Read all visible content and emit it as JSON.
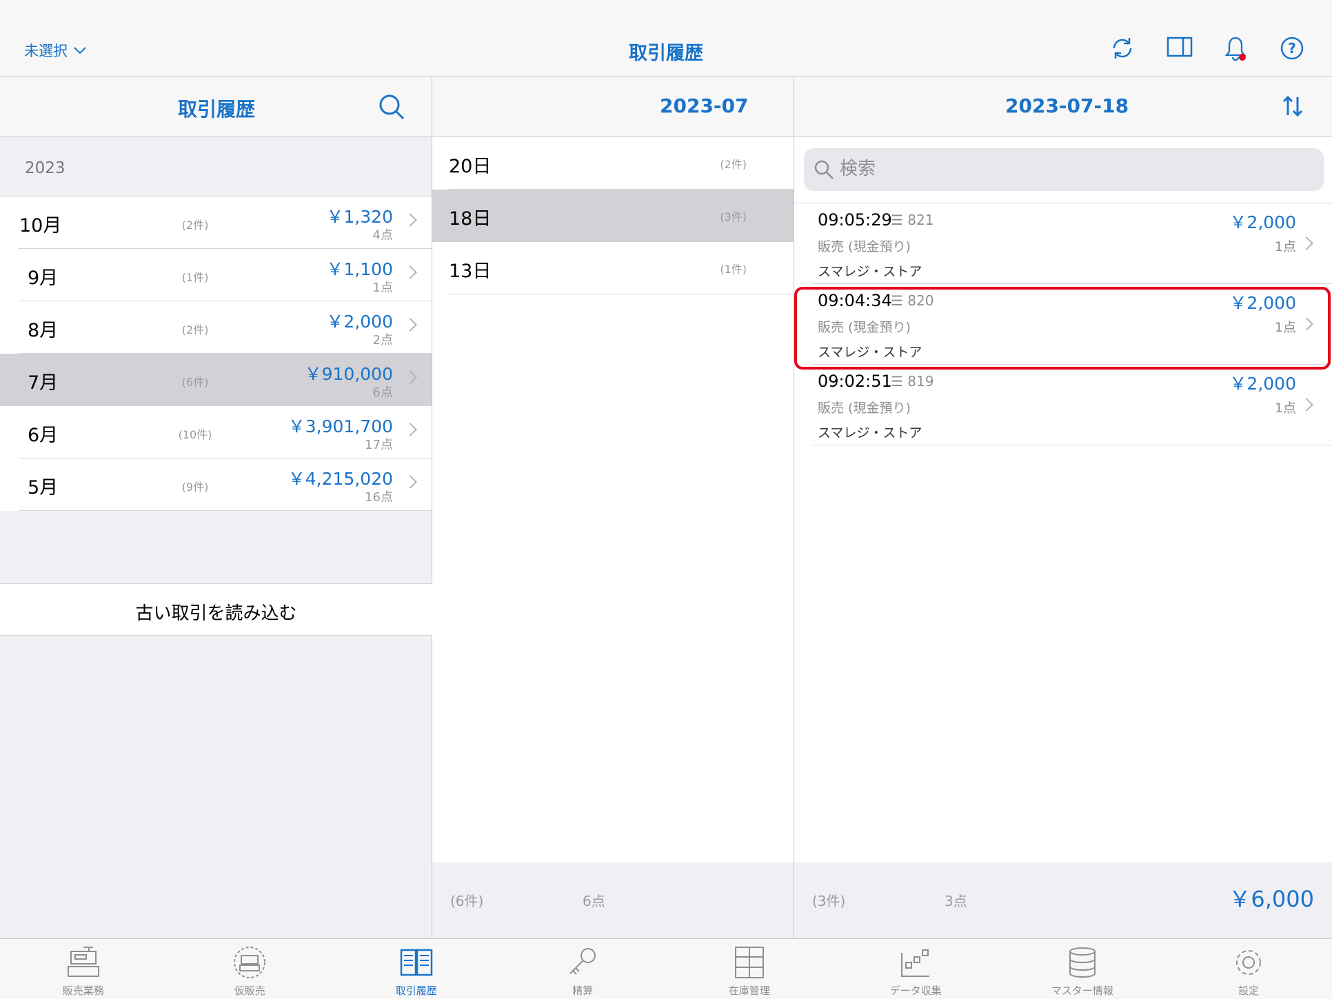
{
  "topbar": {
    "store_select": "未選択",
    "title": "取引履歴",
    "icons": [
      "refresh-icon",
      "split-view-icon",
      "bell-icon",
      "help-icon"
    ]
  },
  "panel1": {
    "title": "取引履歴",
    "year": "2023",
    "months": [
      {
        "label": "10月",
        "count": "(2件)",
        "amount": "￥1,320",
        "points": "4点",
        "selected": false
      },
      {
        "label": "9月",
        "count": "(1件)",
        "amount": "￥1,100",
        "points": "1点",
        "selected": false
      },
      {
        "label": "8月",
        "count": "(2件)",
        "amount": "￥2,000",
        "points": "2点",
        "selected": false
      },
      {
        "label": "7月",
        "count": "(6件)",
        "amount": "￥910,000",
        "points": "6点",
        "selected": true
      },
      {
        "label": "6月",
        "count": "(10件)",
        "amount": "￥3,901,700",
        "points": "17点",
        "selected": false
      },
      {
        "label": "5月",
        "count": "(9件)",
        "amount": "￥4,215,020",
        "points": "16点",
        "selected": false
      }
    ],
    "load_older": "古い取引を読み込む"
  },
  "panel2": {
    "title": "2023-07",
    "days": [
      {
        "label": "20日",
        "count": "(2件)",
        "selected": false
      },
      {
        "label": "18日",
        "count": "(3件)",
        "selected": true
      },
      {
        "label": "13日",
        "count": "(1件)",
        "selected": false
      }
    ],
    "footer": {
      "count": "(6件)",
      "points": "6点"
    }
  },
  "panel3": {
    "title": "2023-07-18",
    "search_placeholder": "検索",
    "transactions": [
      {
        "time": "09:05:29",
        "number": "821",
        "type": "販売 (現金預り)",
        "store": "スマレジ・ストア",
        "amount": "￥2,000",
        "points": "1点",
        "highlighted": false
      },
      {
        "time": "09:04:34",
        "number": "820",
        "type": "販売 (現金預り)",
        "store": "スマレジ・ストア",
        "amount": "￥2,000",
        "points": "1点",
        "highlighted": true
      },
      {
        "time": "09:02:51",
        "number": "819",
        "type": "販売 (現金預り)",
        "store": "スマレジ・ストア",
        "amount": "￥2,000",
        "points": "1点",
        "highlighted": false
      }
    ],
    "footer": {
      "count": "(3件)",
      "points": "3点",
      "total": "￥6,000"
    }
  },
  "tabbar": [
    {
      "label": "販売業務",
      "icon": "register-icon",
      "active": false
    },
    {
      "label": "仮販売",
      "icon": "temp-sale-icon",
      "active": false
    },
    {
      "label": "取引履歴",
      "icon": "history-book-icon",
      "active": true
    },
    {
      "label": "精算",
      "icon": "key-icon",
      "active": false
    },
    {
      "label": "在庫管理",
      "icon": "inventory-icon",
      "active": false
    },
    {
      "label": "データ収集",
      "icon": "data-collection-icon",
      "active": false
    },
    {
      "label": "マスター情報",
      "icon": "database-icon",
      "active": false
    },
    {
      "label": "設定",
      "icon": "gear-icon",
      "active": false
    }
  ],
  "colors": {
    "accent": "#1a73c9",
    "highlight": "#e6001a",
    "badge": "#e6001a"
  }
}
